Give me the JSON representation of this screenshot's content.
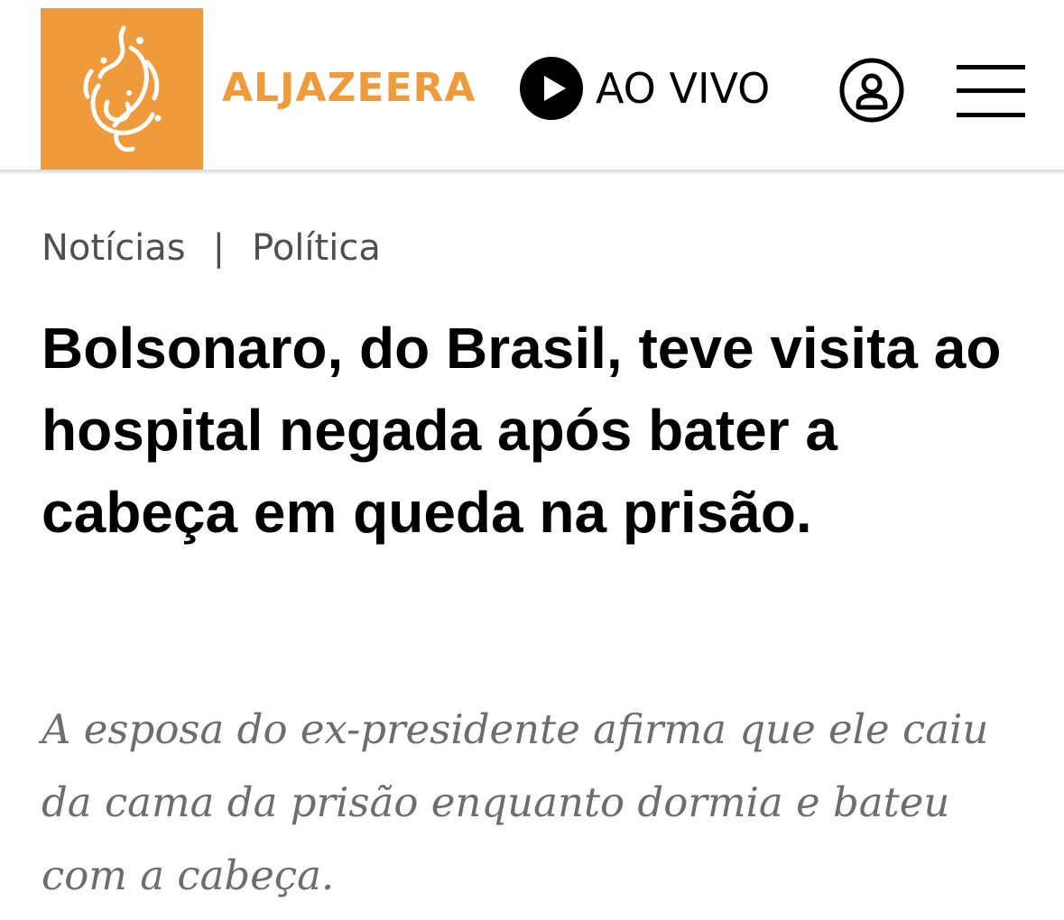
{
  "header": {
    "logo_icon": "aljazeera-calligraphy-logo",
    "wordmark": "ALJAZEERA",
    "live_label": "AO VIVO",
    "live_icon": "play-icon",
    "account_icon": "user-account-icon",
    "menu_icon": "hamburger-menu-icon",
    "brand_color": "#ef9a3b"
  },
  "breadcrumb": {
    "items": [
      "Notícias",
      "Política"
    ],
    "separator": "|"
  },
  "article": {
    "headline": "Bolsonaro, do Brasil, teve visita ao hospital negada após bater a cabeça em queda na prisão.",
    "subheadline": "A esposa do ex-presidente afirma que ele caiu da cama da prisão enquanto dormia e bateu com a cabeça."
  }
}
